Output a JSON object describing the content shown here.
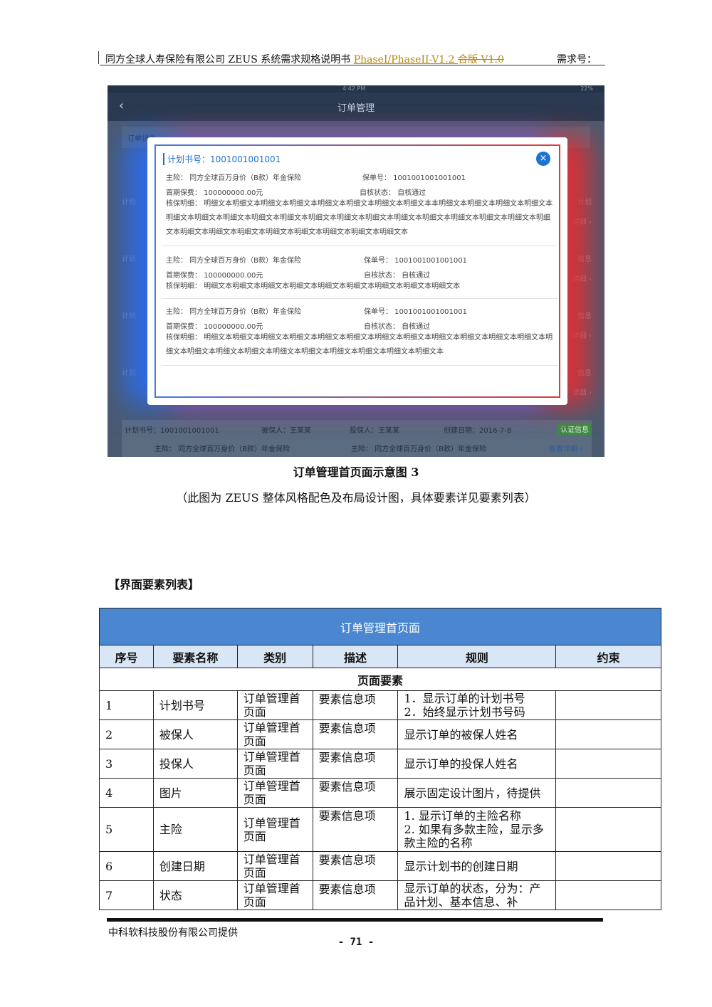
{
  "header": {
    "title": "同方全球人寿保险有限公司 ZEUS 系统需求规格说明书 ",
    "version": "PhaseI/PhaseII-V1.2 ",
    "struck": "合版 V1.0",
    "req_no": "需求号："
  },
  "screenshot": {
    "status_time": "4:42 PM",
    "status_battery": "22%",
    "nav_back": "‹",
    "nav_title": "订单管理",
    "filter_label": "订单状态",
    "bg_left_labels": [
      "计划",
      "计划",
      "计划",
      "计划"
    ],
    "bg_right_labels": [
      "计划",
      "详细 ›",
      "信息",
      "详细 ›",
      "信息",
      "详细 ›",
      "信息",
      "详细 ›"
    ],
    "modal": {
      "plan_no": "计划书号：1001001001001",
      "close": "×",
      "orders": [
        {
          "main": "主险：  同方全球百万身价（B款）年金保险",
          "policy": "保单号：  1001001001001001",
          "premium": "首期保费：  100000000.00元",
          "status": "自核状态：  自核通过",
          "detail": "核保明细：  明细文本明细文本明细文本明细文本明细文本明细文本明细文本明细文本本明细文本明细文本明细文本明细文本明细文本明细文本明细文本明细文本明细文本明细文本明细文本明细文本明细文本明细文本明细文本明细文本明细文本明细文本明细文本明细文本明细文本明细文本明细文本明细文本明细文本明细文本"
        },
        {
          "main": "主险：  同方全球百万身价（B款）年金保险",
          "policy": "保单号：  1001001001001001",
          "premium": "首期保费：  100000000.00元",
          "status": "自核状态：  自核通过",
          "detail": "核保明细：  明细文本明细文本明细文本明细文本明细文本明细文本明细文本明细文本明细文本"
        },
        {
          "main": "主险：  同方全球百万身价（B款）年金保险",
          "policy": "保单号：  1001001001001001",
          "premium": "首期保费：  100000000.00元",
          "status": "自核状态：  自核通过",
          "detail": "核保明细：  明细文本明细文本明细文本明细文本明细文本明细文本明细文本明细文本明细文本明细文本明细文本明细文本明细文本明细文本明细文本明细文本明细文本明细文本明细文本明细文本明细文本明细文本"
        }
      ]
    },
    "bottom_card": {
      "plan_no": "计划书号：1001001001001",
      "insured": "被保人：王某某",
      "holder": "投保人：王某某",
      "date": "创建日期：2016-7-8",
      "tag": "认证信息",
      "main1": "主险：  同方全球百万身价（B款）年金保险",
      "main2": "主险：  同方全球百万身价（B款）年金保险",
      "link": "查看详细 ›"
    }
  },
  "caption": "订单管理首页面示意图 3",
  "caption_note": "（此图为 ZEUS 整体风格配色及布局设计图，具体要素详见要素列表）",
  "section_title": "【界面要素列表】",
  "table": {
    "title": "订单管理首页面",
    "columns": [
      "序号",
      "要素名称",
      "类别",
      "描述",
      "规则",
      "约束"
    ],
    "group": "页面要素",
    "rows": [
      {
        "no": "1",
        "name": "计划书号",
        "type": "订单管理首页面",
        "desc": "要素信息项",
        "rule": "1．显示订单的计划书号\n2．始终显示计划书号码",
        "limit": ""
      },
      {
        "no": "2",
        "name": "被保人",
        "type": "订单管理首页面",
        "desc": "要素信息项",
        "rule": "显示订单的被保人姓名",
        "limit": ""
      },
      {
        "no": "3",
        "name": "投保人",
        "type": "订单管理首页面",
        "desc": "要素信息项",
        "rule": "显示订单的投保人姓名",
        "limit": ""
      },
      {
        "no": "4",
        "name": "图片",
        "type": "订单管理首页面",
        "desc": "要素信息项",
        "rule": "展示固定设计图片，待提供",
        "limit": ""
      },
      {
        "no": "5",
        "name": "主险",
        "type": "订单管理首页面",
        "desc": "要素信息项",
        "rule": "1. 显示订单的主险名称\n2. 如果有多款主险，显示多款主险的名称",
        "limit": ""
      },
      {
        "no": "6",
        "name": "创建日期",
        "type": "订单管理首页面",
        "desc": "要素信息项",
        "rule": "显示计划书的创建日期",
        "limit": ""
      },
      {
        "no": "7",
        "name": "状态",
        "type": "订单管理首页面",
        "desc": "要素信息项",
        "rule": "显示订单的状态，分为：产品计划、基本信息、补",
        "limit": ""
      }
    ]
  },
  "footer": {
    "company": "中科软科技股份有限公司提供",
    "page": "- 71 -"
  }
}
